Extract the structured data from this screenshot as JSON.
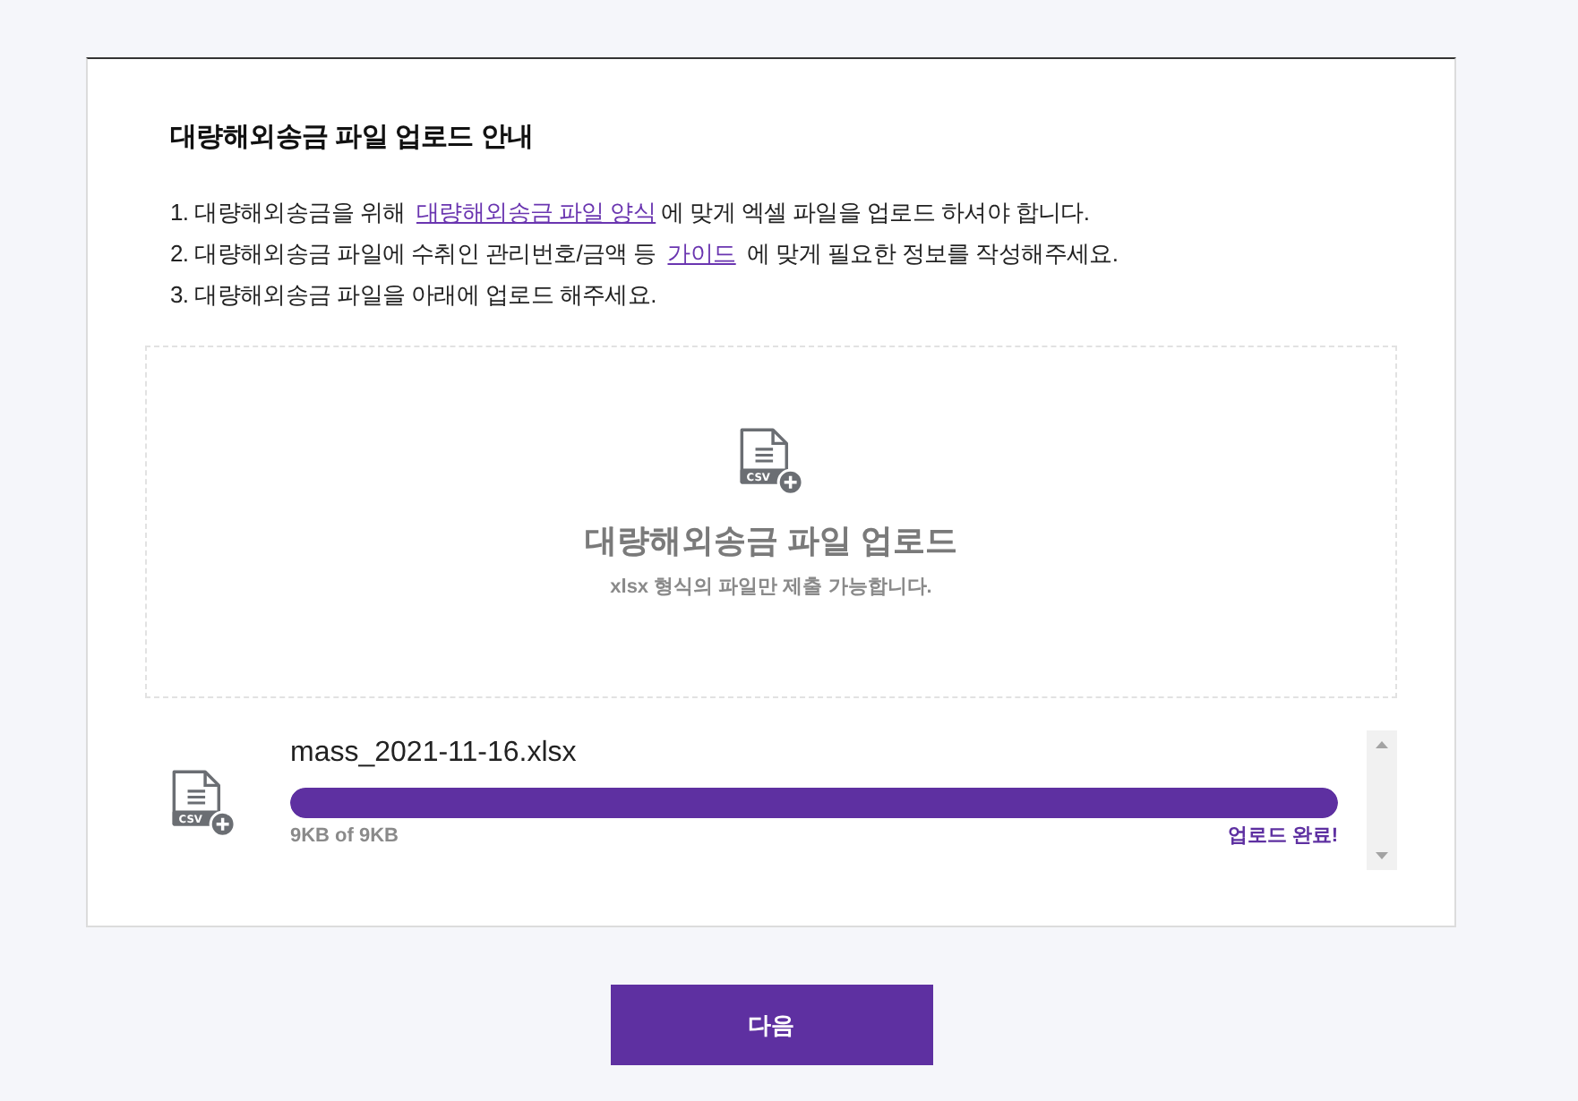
{
  "guide": {
    "title": "대량해외송금 파일 업로드 안내",
    "steps": [
      [
        {
          "kind": "text",
          "text": "1. 대량해외송금을 위해 "
        },
        {
          "kind": "link",
          "text": "대량해외송금 파일 양식"
        },
        {
          "kind": "text",
          "text": "에 맞게 엑셀 파일을 업로드 하셔야 합니다."
        }
      ],
      [
        {
          "kind": "text",
          "text": "2. 대량해외송금 파일에 수취인 관리번호/금액 등 "
        },
        {
          "kind": "link",
          "text": "가이드"
        },
        {
          "kind": "text",
          "text": " 에 맞게 필요한 정보를 작성해주세요."
        }
      ],
      [
        {
          "kind": "text",
          "text": "3. 대량해외송금 파일을 아래에 업로드 해주세요."
        }
      ]
    ]
  },
  "dropzone": {
    "icon_label": "CSV",
    "title": "대량해외송금 파일 업로드",
    "hint": "xlsx 형식의 파일만 제출 가능합니다."
  },
  "files": [
    {
      "icon_label": "CSV",
      "name": "mass_2021-11-16.xlsx",
      "level": 1,
      "size": "9KB of 9KB",
      "status": "업로드 완료!"
    }
  ],
  "next_button": "다음"
}
